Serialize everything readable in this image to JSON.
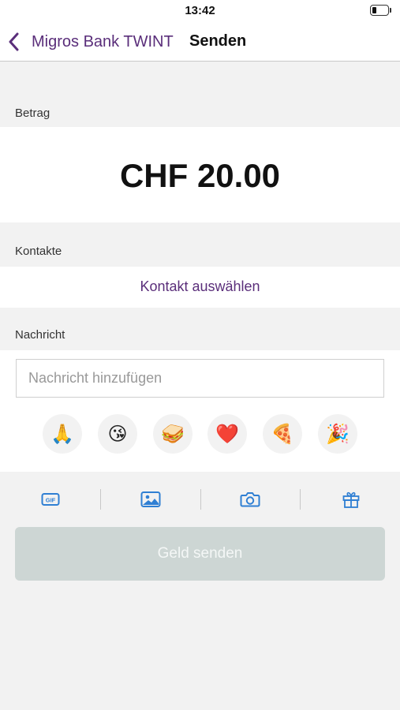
{
  "status_bar": {
    "time": "13:42"
  },
  "nav": {
    "back_label": "Migros Bank TWINT",
    "title": "Senden"
  },
  "amount_section": {
    "label": "Betrag",
    "value": "CHF 20.00"
  },
  "contacts_section": {
    "label": "Kontakte",
    "link": "Kontakt auswählen"
  },
  "message_section": {
    "label": "Nachricht",
    "placeholder": "Nachricht hinzufügen",
    "emojis": [
      {
        "name": "folded-hands",
        "glyph": "🙏"
      },
      {
        "name": "kissing-face",
        "glyph": "😘"
      },
      {
        "name": "sandwich",
        "glyph": "🥪"
      },
      {
        "name": "red-heart",
        "glyph": "❤️"
      },
      {
        "name": "pizza",
        "glyph": "🍕"
      },
      {
        "name": "party-popper",
        "glyph": "🎉"
      }
    ]
  },
  "attachments": [
    {
      "icon": "gif-icon"
    },
    {
      "icon": "image-icon"
    },
    {
      "icon": "camera-icon"
    },
    {
      "icon": "gift-icon"
    }
  ],
  "send_button": {
    "label": "Geld senden",
    "enabled": false
  },
  "colors": {
    "accent": "#5a2e7a",
    "icon_blue": "#2f7fd3",
    "disabled_button": "#cdd6d4",
    "background": "#f2f2f2"
  }
}
